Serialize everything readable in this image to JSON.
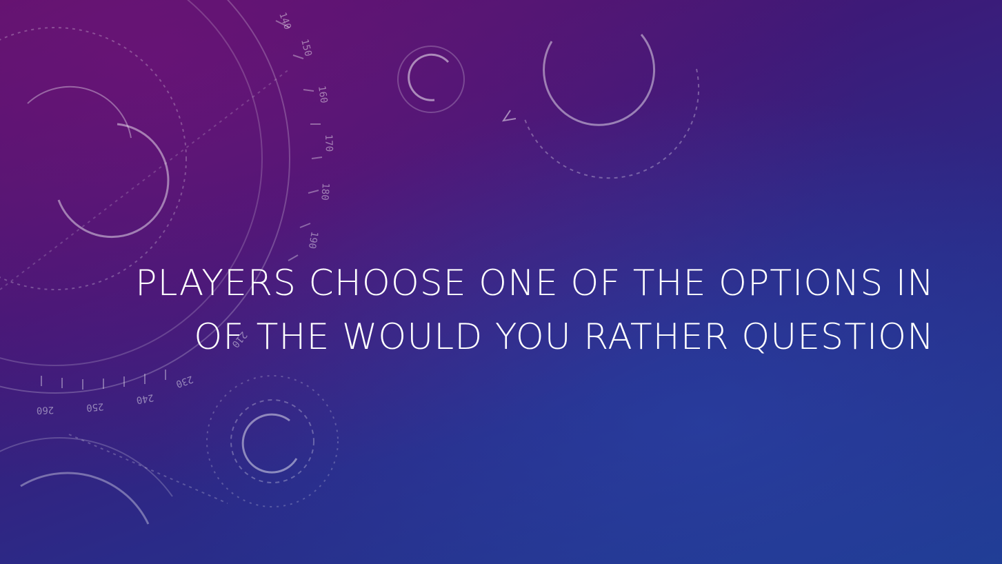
{
  "slide": {
    "title_lines": [
      "PLAYERS CHOOSE ONE OF THE OPTIONS IN",
      "OF THE WOULD YOU RATHER QUESTION"
    ],
    "dial_numbers": [
      "140",
      "150",
      "160",
      "170",
      "180",
      "190",
      "210",
      "230",
      "240",
      "250",
      "260"
    ]
  },
  "colors": {
    "background_top": "#5a1268",
    "background_bottom": "#1f3c92",
    "title_text": "#ffffff"
  }
}
